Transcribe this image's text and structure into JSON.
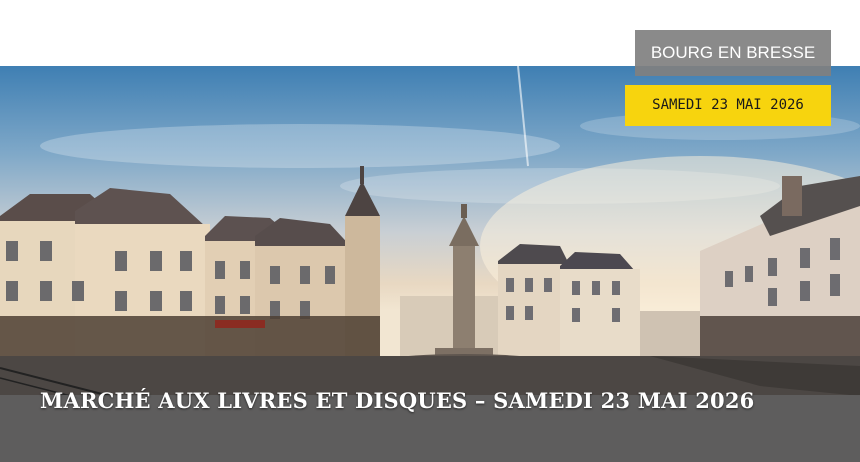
{
  "header": {
    "city": "BOURG EN BRESSE",
    "date": "SAMEDI 23 MAI 2026"
  },
  "hero": {
    "caption": "MARCHÉ AUX LIVRES ET DISQUES – SAMEDI 23 MAI 2026"
  },
  "colors": {
    "date_badge": "#f7d40e",
    "city_badge": "#808080",
    "caption_band": "#606060"
  }
}
